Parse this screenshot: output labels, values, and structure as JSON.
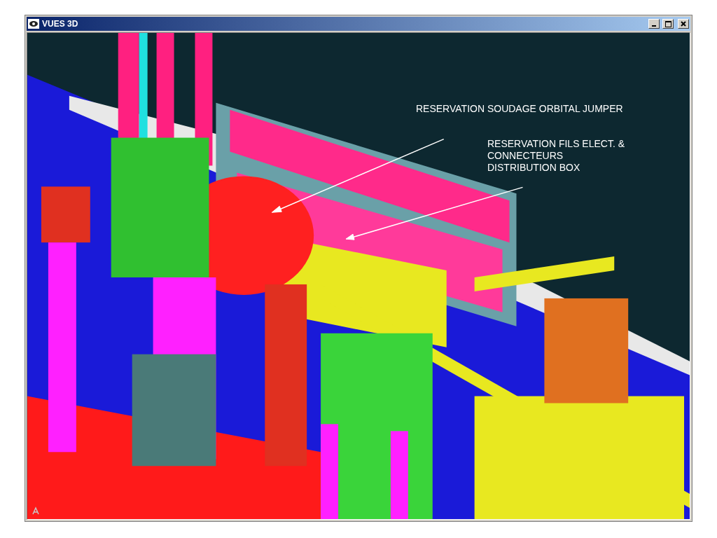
{
  "window": {
    "title": "VUES 3D"
  },
  "annotations": [
    {
      "lines": [
        "RESERVATION SOUDAGE ORBITAL JUMPER"
      ]
    },
    {
      "lines": [
        "RESERVATION FILS ELECT. &",
        "CONNECTEURS",
        "DISTRIBUTION BOX"
      ]
    }
  ]
}
